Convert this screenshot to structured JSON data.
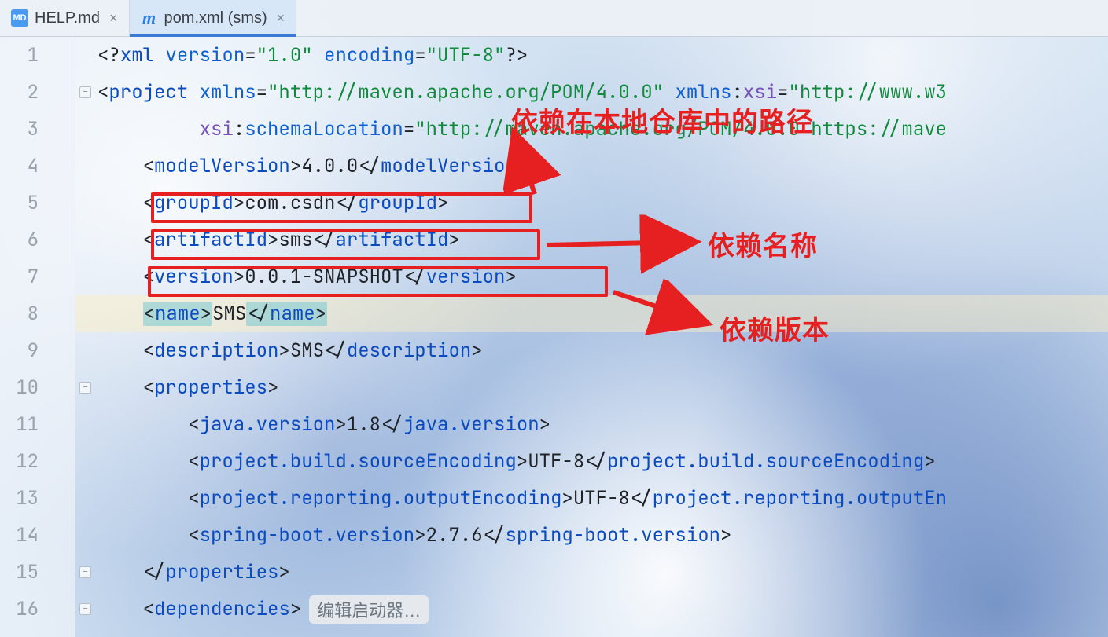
{
  "tabs": [
    {
      "icon": "md",
      "label": "HELP.md",
      "active": false
    },
    {
      "icon": "maven",
      "label": "pom.xml (sms)",
      "active": true
    }
  ],
  "gutter": [
    "1",
    "2",
    "3",
    "4",
    "5",
    "6",
    "7",
    "8",
    "9",
    "10",
    "11",
    "12",
    "13",
    "14",
    "15",
    "16"
  ],
  "code": {
    "l1": {
      "pi_open": "<?",
      "pi_name": "xml",
      "a1": "version",
      "v1": "\"1.0\"",
      "a2": "encoding",
      "v2": "\"UTF-8\"",
      "pi_close": "?>"
    },
    "l2": {
      "tag": "project",
      "a1": "xmlns",
      "v1": "\"http://maven.apache.org/POM/4.0.0\"",
      "a2p": "xmlns",
      "a2l": "xsi",
      "v2": "\"http://www.w3"
    },
    "l3": {
      "ap": "xsi",
      "al": "schemaLocation",
      "v": "\"http://maven.apache.org/POM/4.0.0 https://mave"
    },
    "l4": {
      "tag": "modelVersion",
      "text": "4.0.0"
    },
    "l5": {
      "tag": "groupId",
      "text": "com.csdn"
    },
    "l6": {
      "tag": "artifactId",
      "text": "sms"
    },
    "l7": {
      "tag": "version",
      "text": "0.0.1-SNAPSHOT"
    },
    "l8": {
      "tag": "name",
      "text": "SMS"
    },
    "l9": {
      "tag": "description",
      "text": "SMS"
    },
    "l10": {
      "tag": "properties"
    },
    "l11": {
      "tag": "java.version",
      "text": "1.8"
    },
    "l12": {
      "tag": "project.build.sourceEncoding",
      "text": "UTF-8"
    },
    "l13": {
      "tag": "project.reporting.outputEncoding",
      "text": "UTF-8",
      "closeSuffix": "project.reporting.outputEn"
    },
    "l14": {
      "tag": "spring-boot.version",
      "text": "2.7.6"
    },
    "l15": {
      "close": "properties"
    },
    "l16": {
      "tag": "dependencies",
      "hint": "编辑启动器…"
    }
  },
  "annotations": {
    "path_label": "依赖在本地仓库中的路径",
    "name_label": "依赖名称",
    "version_label": "依赖版本"
  },
  "colors": {
    "accent_red": "#e62020",
    "tab_underline": "#3a7bd5"
  }
}
